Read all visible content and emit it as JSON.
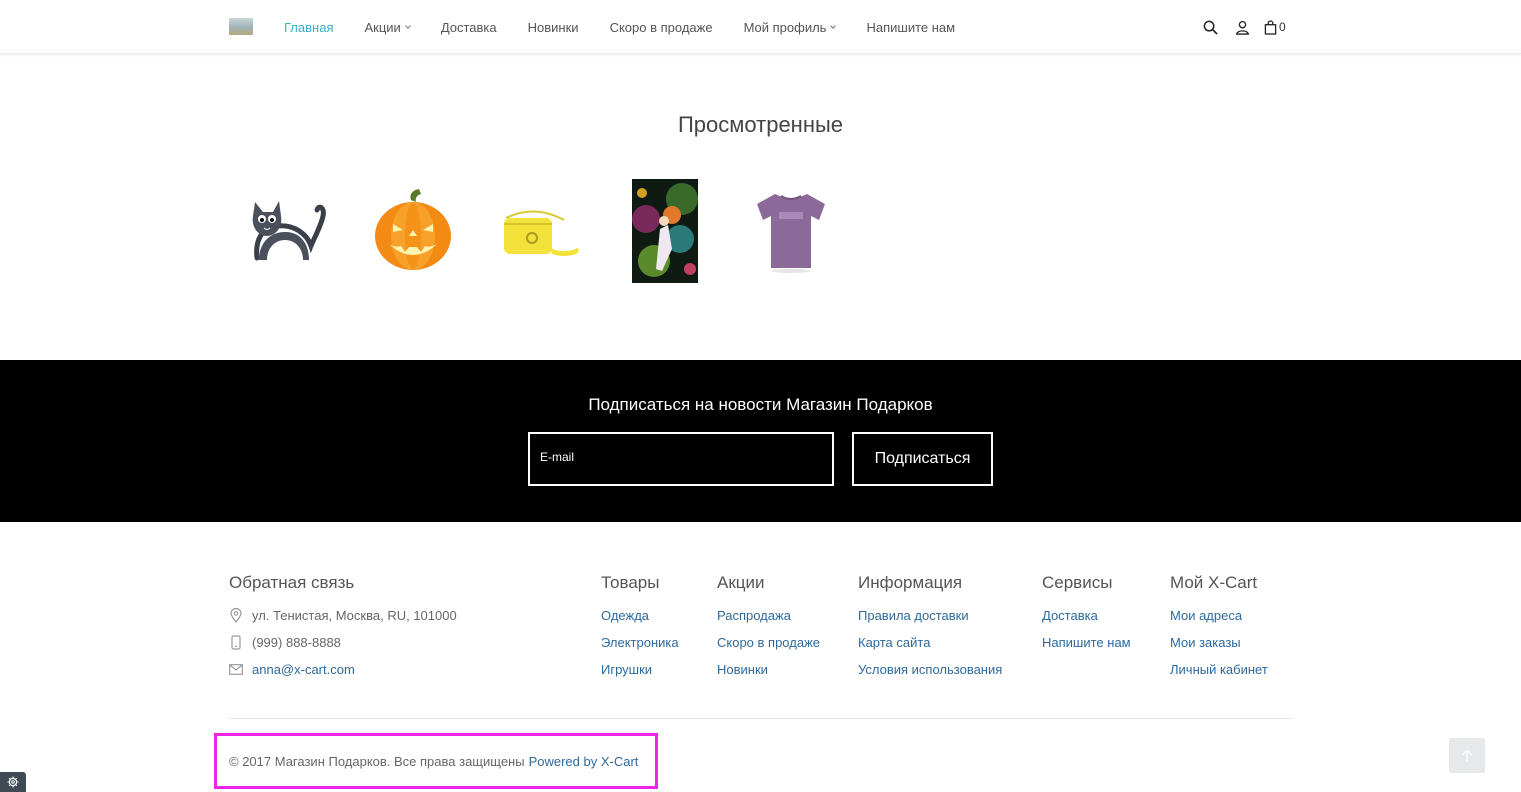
{
  "header": {
    "nav": [
      {
        "label": "Главная",
        "active": true,
        "dropdown": false
      },
      {
        "label": "Акции",
        "active": false,
        "dropdown": true
      },
      {
        "label": "Доставка",
        "active": false,
        "dropdown": false
      },
      {
        "label": "Новинки",
        "active": false,
        "dropdown": false
      },
      {
        "label": "Скоро в продаже",
        "active": false,
        "dropdown": false
      },
      {
        "label": "Мой профиль",
        "active": false,
        "dropdown": true
      },
      {
        "label": "Напишите нам",
        "active": false,
        "dropdown": false
      }
    ],
    "cart_count": "0",
    "icons": [
      "search-icon",
      "user-icon",
      "shopping-bag-icon"
    ]
  },
  "recent": {
    "title": "Просмотренные",
    "products": [
      "cat-figure",
      "pumpkin",
      "yellow-handbag",
      "fantasy-art-print",
      "purple-tshirt"
    ]
  },
  "newsletter": {
    "title": "Подписаться на новости Магазин Подарков",
    "placeholder": "E-mail",
    "button": "Подписаться"
  },
  "footer": {
    "contact": {
      "title": "Обратная связь",
      "address": "ул. Тенистая, Москва, RU, 101000",
      "phone": "(999) 888-8888",
      "email": "anna@x-cart.com"
    },
    "columns": [
      {
        "title": "Товары",
        "links": [
          "Одежда",
          "Электроника",
          "Игрушки"
        ]
      },
      {
        "title": "Акции",
        "links": [
          "Распродажа",
          "Скоро в продаже",
          "Новинки"
        ]
      },
      {
        "title": "Информация",
        "links": [
          "Правила доставки",
          "Карта сайта",
          "Условия использования"
        ]
      },
      {
        "title": "Сервисы",
        "links": [
          "Доставка",
          "Напишите нам"
        ]
      },
      {
        "title": "Мой X-Cart",
        "links": [
          "Мои адреса",
          "Мои заказы",
          "Личный кабинет"
        ]
      }
    ],
    "copyright": "© 2017 Магазин Подарков. Все права защищены",
    "powered": "Powered by X-Cart"
  },
  "colors": {
    "accent": "#35b0c7",
    "link": "#2d6a9f",
    "highlight": "#ee24e6",
    "newsletter_bg": "#000000"
  }
}
